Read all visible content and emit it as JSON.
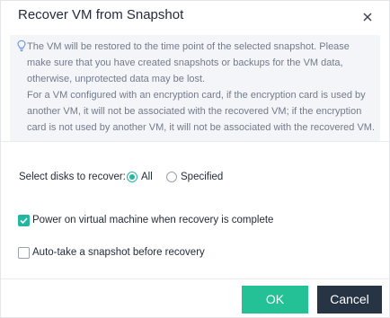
{
  "dialog": {
    "title": "Recover VM from Snapshot",
    "close_icon": "close-icon"
  },
  "notice": {
    "icon": "bulb-icon",
    "paragraph1": "The VM will be restored to the time point of the selected snapshot. Please make sure that you have created snapshots or backups for the VM data, otherwise, unprotected data may be lost.",
    "paragraph2": "For a VM configured with an encryption card, if the encryption card is used by another VM, it will not be associated with the recovered VM; if the encryption card is not used by another VM, it will not be associated with the recovered VM."
  },
  "disks": {
    "label": "Select disks to recover:",
    "options": [
      {
        "label": "All",
        "selected": true
      },
      {
        "label": "Specified",
        "selected": false
      }
    ]
  },
  "options": {
    "power_on": {
      "label": "Power on virtual machine when recovery is complete",
      "checked": true
    },
    "auto_snapshot": {
      "label": "Auto-take a snapshot before recovery",
      "checked": false
    }
  },
  "footer": {
    "ok_label": "OK",
    "cancel_label": "Cancel"
  },
  "colors": {
    "accent": "#25b6a1",
    "ok_button": "#25c196",
    "cancel_button": "#273444",
    "notice_bg": "#f3f5f9"
  }
}
